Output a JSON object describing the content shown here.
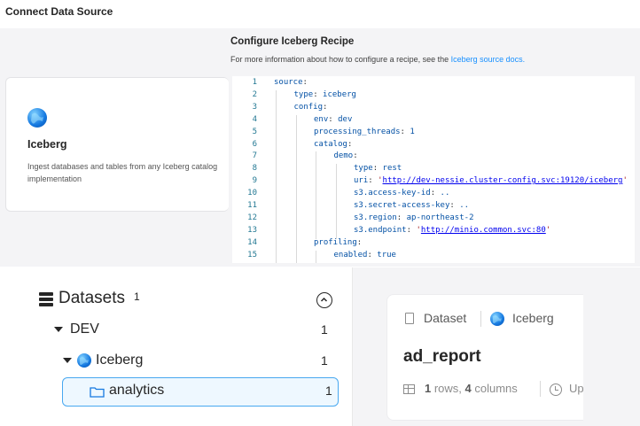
{
  "page": {
    "title": "Connect Data Source"
  },
  "recipe": {
    "title": "Configure Iceberg Recipe",
    "subtitle_prefix": "For more information about how to configure a recipe, see the ",
    "docs_link": "Iceberg source docs."
  },
  "source_card": {
    "name": "Iceberg",
    "description_line1": "Ingest databases and tables from any Iceberg catalog",
    "description_line2": "implementation"
  },
  "editor": {
    "lines": [
      {
        "n": "1",
        "key": "source",
        "indent": 0
      },
      {
        "n": "2",
        "key": "type",
        "value": "iceberg",
        "indent": 1
      },
      {
        "n": "3",
        "key": "config",
        "indent": 1
      },
      {
        "n": "4",
        "key": "env",
        "value": "dev",
        "indent": 2
      },
      {
        "n": "5",
        "key": "processing_threads",
        "value": "1",
        "indent": 2
      },
      {
        "n": "6",
        "key": "catalog",
        "indent": 2
      },
      {
        "n": "7",
        "key": "demo",
        "indent": 3
      },
      {
        "n": "8",
        "key": "type",
        "value": "rest",
        "indent": 4
      },
      {
        "n": "9",
        "key": "uri",
        "url": "http://dev-nessie.cluster-config.svc:19120/iceberg",
        "indent": 4
      },
      {
        "n": "10",
        "key": "s3.access-key-id",
        "value": "..",
        "indent": 4
      },
      {
        "n": "11",
        "key": "s3.secret-access-key",
        "value": "..",
        "indent": 4
      },
      {
        "n": "12",
        "key": "s3.region",
        "value": "ap-northeast-2",
        "indent": 4
      },
      {
        "n": "13",
        "key": "s3.endpoint",
        "url": "http://minio.common.svc:80",
        "indent": 4
      },
      {
        "n": "14",
        "key": "profiling",
        "indent": 2
      },
      {
        "n": "15",
        "key": "enabled",
        "value": "true",
        "indent": 3
      }
    ]
  },
  "datasets_panel": {
    "title": "Datasets",
    "count": "1",
    "tree": [
      {
        "label": "DEV",
        "count": "1"
      },
      {
        "label": "Iceberg",
        "count": "1"
      },
      {
        "label": "analytics",
        "count": "1"
      }
    ]
  },
  "entity_card": {
    "type": "Dataset",
    "platform": "Iceberg",
    "name": "ad_report",
    "rows": "1",
    "rows_label": " rows, ",
    "columns": "4",
    "columns_label": " columns",
    "updated_fragment": "Up"
  },
  "colors": {
    "accent": "#1890ff",
    "selected_border": "#48a8f0",
    "selected_bg": "#eef8ff",
    "yaml_key": "#0451a5",
    "yaml_string": "#a31515"
  }
}
